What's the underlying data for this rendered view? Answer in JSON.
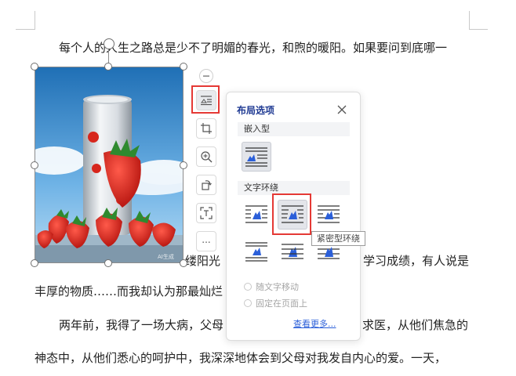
{
  "document": {
    "line1": "每个人的人生之路总是少不了明媚的春光，和煦的暖阳。如果要问到底哪一",
    "line2a": "缕阳光",
    "line2b": "学习成绩，有人说是",
    "line3": "丰厚的物质……而我却认为那最灿烂",
    "line4a": "两年前，我得了一场大病，父母",
    "line4b": "求医，从他们焦急的",
    "line5": "神态中，从他们悉心的呵护中，我深深地体会到父母对我发自内心的爱。一天，"
  },
  "image": {
    "alt_icon": "strawberry-can-image",
    "watermark": "AI生成"
  },
  "toolbar": {
    "buttons": [
      "layout-options",
      "crop",
      "zoom",
      "rotate",
      "extract-text",
      "more"
    ],
    "more_label": "..."
  },
  "layout_panel": {
    "title": "布局选项",
    "inline_section": "嵌入型",
    "wrap_section": "文字环绕",
    "move_with_text": "随文字移动",
    "fix_on_page": "固定在页面上",
    "see_more": "查看更多..."
  },
  "tooltip": {
    "text": "紧密型环绕"
  },
  "colors": {
    "accent": "#2b5fd9",
    "highlight": "#e53935",
    "panel_title": "#1f3a93"
  }
}
